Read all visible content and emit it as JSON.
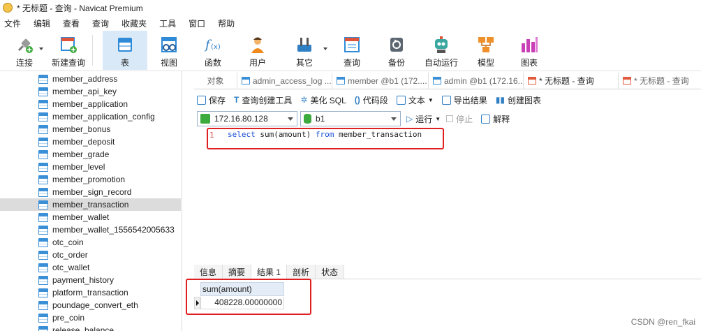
{
  "window": {
    "title": "* 无标题 - 查询 - Navicat Premium"
  },
  "menu": [
    "文件",
    "编辑",
    "查看",
    "查询",
    "收藏夹",
    "工具",
    "窗口",
    "帮助"
  ],
  "toolbar": {
    "connect": "连接",
    "new_query": "新建查询",
    "table": "表",
    "view": "视图",
    "function": "函数",
    "user": "用户",
    "other": "其它",
    "query": "查询",
    "backup": "备份",
    "automation": "自动运行",
    "model": "模型",
    "chart": "图表"
  },
  "sidebar": {
    "items": [
      "member_address",
      "member_api_key",
      "member_application",
      "member_application_config",
      "member_bonus",
      "member_deposit",
      "member_grade",
      "member_level",
      "member_promotion",
      "member_sign_record",
      "member_transaction",
      "member_wallet",
      "member_wallet_1556542005633",
      "otc_coin",
      "otc_order",
      "otc_wallet",
      "payment_history",
      "platform_transaction",
      "poundage_convert_eth",
      "pre_coin",
      "release_balance"
    ],
    "selected": "member_transaction"
  },
  "tabs": [
    "对象",
    "admin_access_log ...",
    "member @b1 (172....",
    "admin @b1 (172.16....",
    "* 无标题 - 查询",
    "* 无标题 - 查询"
  ],
  "query_toolbar": {
    "save": "保存",
    "query_builder": "查询创建工具",
    "beautify": "美化 SQL",
    "snippet": "代码段",
    "text": "文本",
    "export": "导出结果",
    "create_chart": "创建图表"
  },
  "connection": {
    "host": "172.16.80.128",
    "database": "b1",
    "run": "运行",
    "stop": "停止",
    "explain": "解释"
  },
  "editor": {
    "line_number": "1",
    "kw_select": "select",
    "mid": " sum(amount) ",
    "kw_from": "from",
    "tail": " member_transaction"
  },
  "result_tabs": [
    "信息",
    "摘要",
    "结果 1",
    "剖析",
    "状态"
  ],
  "result": {
    "column": "sum(amount)",
    "value": "408228.00000000"
  },
  "watermark": "CSDN @ren_fkai",
  "colors": {
    "accent": "#2f8bd8",
    "highlight": "#e02020",
    "keyword": "#1a4fd6"
  }
}
